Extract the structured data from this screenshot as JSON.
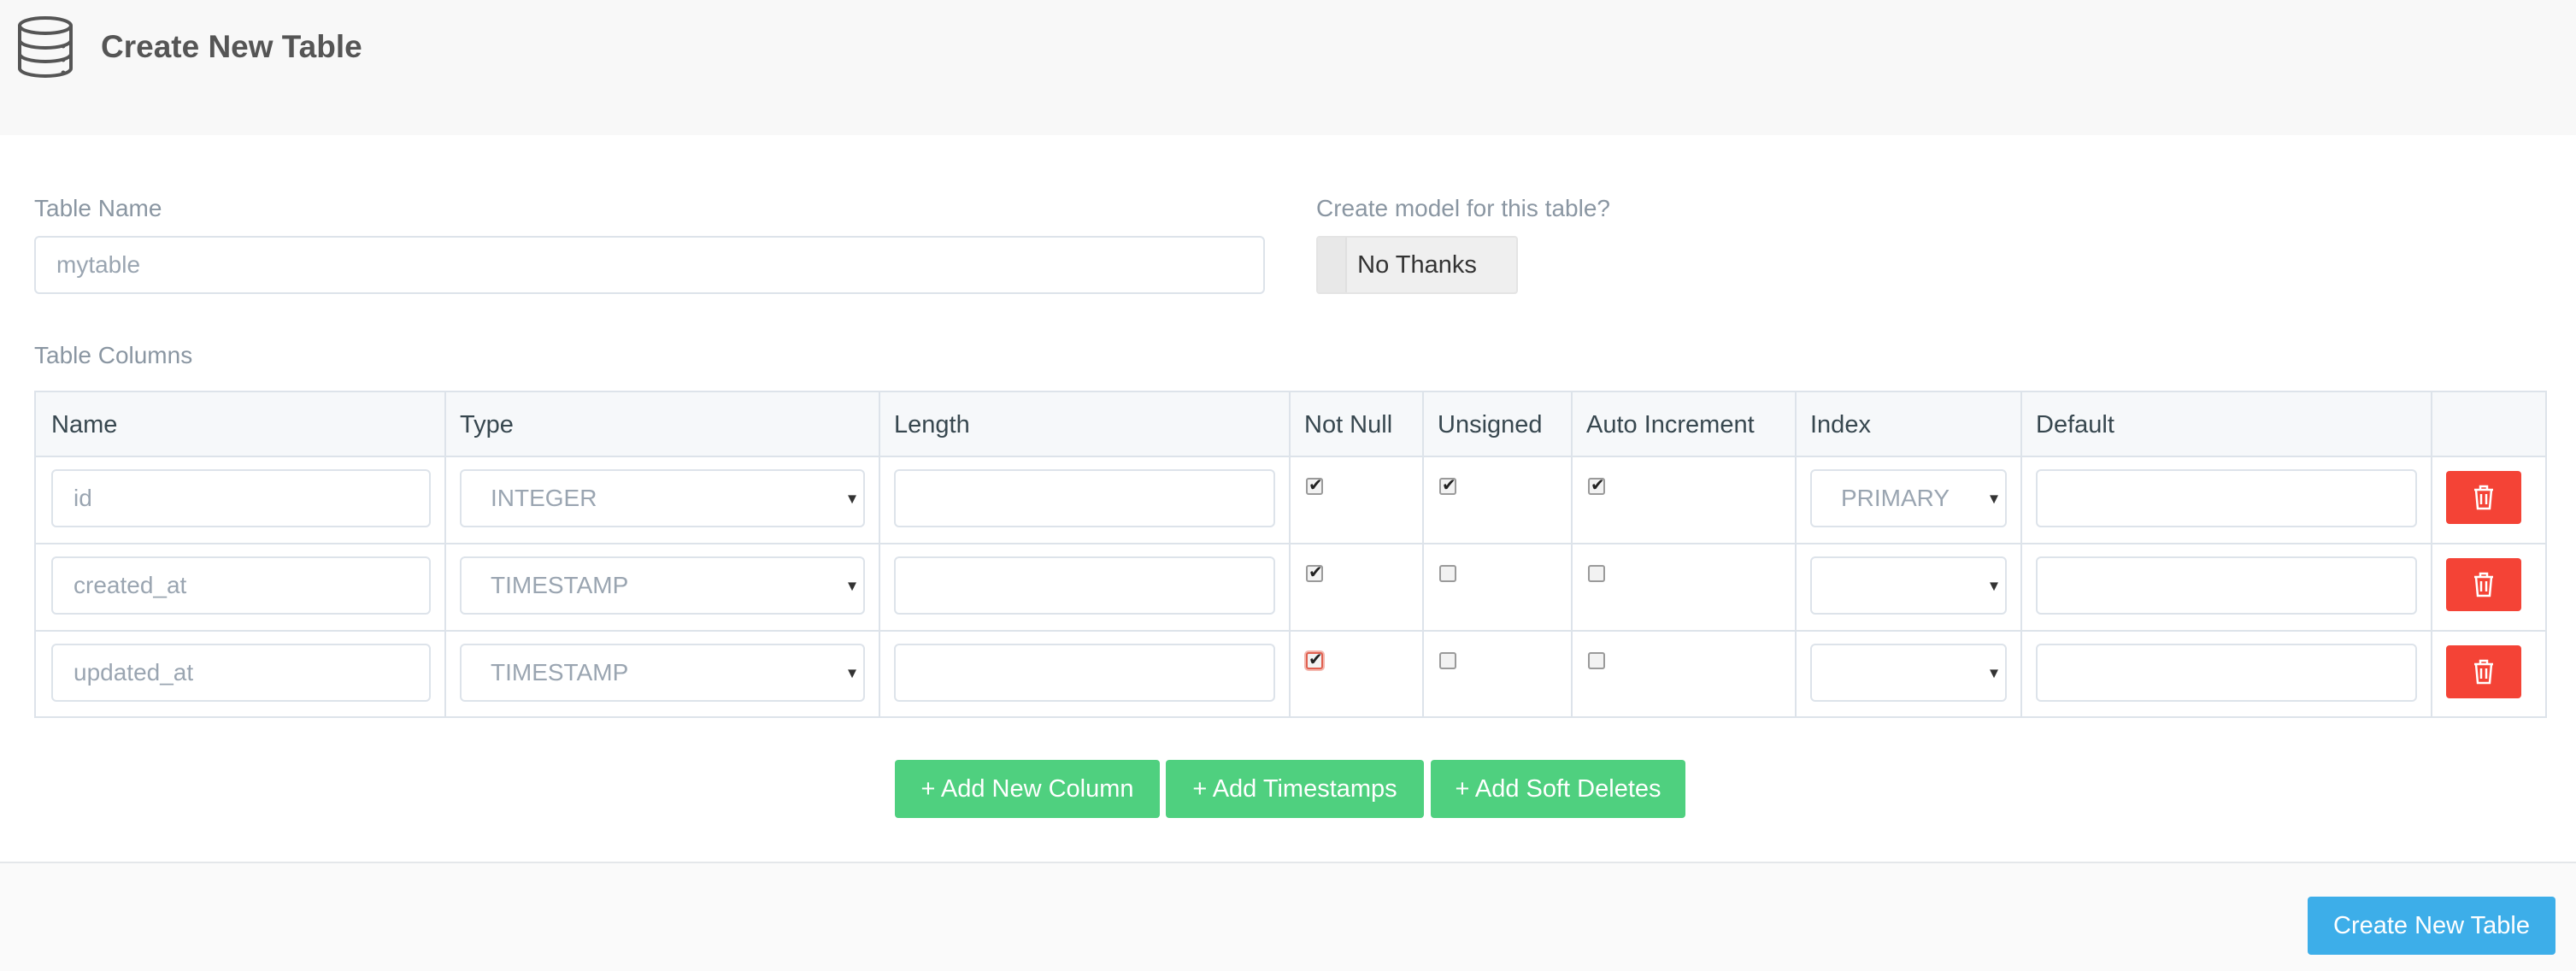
{
  "header": {
    "icon": "database-icon",
    "title": "Create New Table"
  },
  "form": {
    "table_name_label": "Table Name",
    "table_name_value": "mytable",
    "model_label": "Create model for this table?",
    "model_button": "No Thanks",
    "columns_label": "Table Columns"
  },
  "table": {
    "headers": [
      "Name",
      "Type",
      "Length",
      "Not Null",
      "Unsigned",
      "Auto Increment",
      "Index",
      "Default"
    ],
    "rows": [
      {
        "name": "id",
        "type": "INTEGER",
        "length": "",
        "not_null": true,
        "unsigned": true,
        "auto_increment": true,
        "index": "PRIMARY",
        "default": ""
      },
      {
        "name": "created_at",
        "type": "TIMESTAMP",
        "length": "",
        "not_null": true,
        "unsigned": false,
        "auto_increment": false,
        "index": "",
        "default": ""
      },
      {
        "name": "updated_at",
        "type": "TIMESTAMP",
        "length": "",
        "not_null": true,
        "unsigned": false,
        "auto_increment": false,
        "index": "",
        "default": ""
      }
    ]
  },
  "actions": {
    "add_column": "+ Add New Column",
    "add_timestamps": "+ Add Timestamps",
    "add_soft_deletes": "+ Add Soft Deletes",
    "submit": "Create New Table"
  },
  "colors": {
    "green": "#4fd07f",
    "blue": "#3daee9",
    "red": "#f44336"
  }
}
